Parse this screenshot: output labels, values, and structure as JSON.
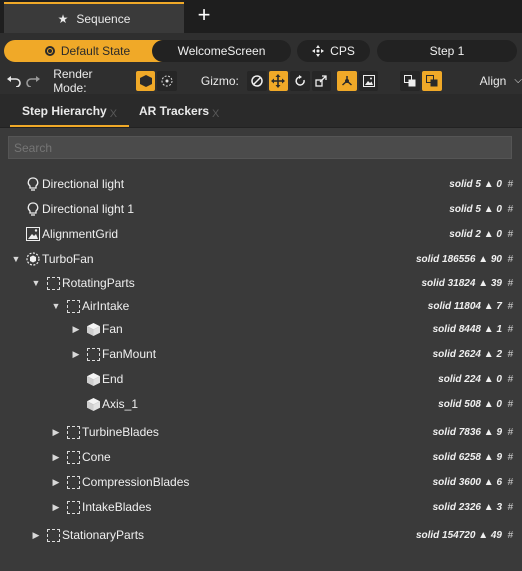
{
  "titlebar": {
    "tab_label": "Sequence",
    "tab_icon": "star-icon",
    "new_tab_icon": "plus-icon"
  },
  "states": {
    "default_state": "Default State",
    "welcome_screen": "WelcomeScreen",
    "cps": "CPS",
    "step1": "Step 1"
  },
  "toolbar": {
    "render_mode_label": "Render Mode:",
    "gizmo_label": "Gizmo:",
    "align_label": "Align"
  },
  "panel_tabs": {
    "step_hierarchy": "Step Hierarchy",
    "ar_trackers": "AR Trackers",
    "close_glyph": "X"
  },
  "search": {
    "placeholder": "Search"
  },
  "tree": [
    {
      "name": "Directional light",
      "meta": "solid 5 ▲ 0",
      "icon": "bulb-icon",
      "depth": 0,
      "arrow": ""
    },
    {
      "name": "Directional light 1",
      "meta": "solid 5 ▲ 0",
      "icon": "bulb-icon",
      "depth": 0,
      "arrow": ""
    },
    {
      "name": "AlignmentGrid",
      "meta": "solid 2 ▲ 0",
      "icon": "grid-image-icon",
      "depth": 0,
      "arrow": ""
    },
    {
      "name": "TurboFan",
      "meta": "solid 186556 ▲ 90",
      "icon": "assembly-icon",
      "depth": 0,
      "arrow": "expanded"
    },
    {
      "name": "RotatingParts",
      "meta": "solid 31824 ▲ 39",
      "icon": "group-icon",
      "depth": 1,
      "arrow": "expanded"
    },
    {
      "name": "AirIntake",
      "meta": "solid 11804 ▲ 7",
      "icon": "group-icon",
      "depth": 2,
      "arrow": "expanded"
    },
    {
      "name": "Fan",
      "meta": "solid 8448 ▲ 1",
      "icon": "cube-icon",
      "depth": 3,
      "arrow": "collapsed"
    },
    {
      "name": "FanMount",
      "meta": "solid 2624 ▲ 2",
      "icon": "group-icon",
      "depth": 3,
      "arrow": "collapsed"
    },
    {
      "name": "End",
      "meta": "solid 224 ▲ 0",
      "icon": "cube-icon",
      "depth": 3,
      "arrow": ""
    },
    {
      "name": "Axis_1",
      "meta": "solid 508 ▲ 0",
      "icon": "cube-icon",
      "depth": 3,
      "arrow": ""
    },
    {
      "name": "TurbineBlades",
      "meta": "solid 7836 ▲ 9",
      "icon": "group-icon",
      "depth": 2,
      "arrow": "collapsed"
    },
    {
      "name": "Cone",
      "meta": "solid 6258 ▲ 9",
      "icon": "group-icon",
      "depth": 2,
      "arrow": "collapsed"
    },
    {
      "name": "CompressionBlades",
      "meta": "solid 3600 ▲ 6",
      "icon": "group-icon",
      "depth": 2,
      "arrow": "collapsed"
    },
    {
      "name": "IntakeBlades",
      "meta": "solid 2326 ▲ 3",
      "icon": "group-icon",
      "depth": 2,
      "arrow": "collapsed"
    },
    {
      "name": "StationaryParts",
      "meta": "solid 154720 ▲ 49",
      "icon": "group-icon",
      "depth": 1,
      "arrow": "collapsed"
    }
  ],
  "colors": {
    "accent": "#f0a928",
    "background": "#3a3a3a",
    "header": "#1e1e1e"
  }
}
